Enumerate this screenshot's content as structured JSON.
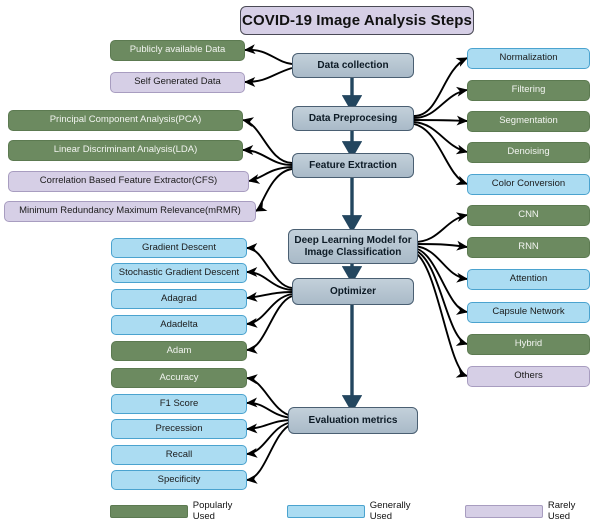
{
  "title": {
    "text": "COVID-19 Image Analysis Steps"
  },
  "spine": [
    {
      "id": "data-collection",
      "label": "Data collection"
    },
    {
      "id": "data-preprocessing",
      "label": "Data Preprocesing"
    },
    {
      "id": "feature-extraction",
      "label": "Feature Extraction"
    },
    {
      "id": "deep-learning-model",
      "label": "Deep Learning Model for Image Classification"
    },
    {
      "id": "optimizer",
      "label": "Optimizer"
    },
    {
      "id": "evaluation-metrics",
      "label": "Evaluation metrics"
    }
  ],
  "data_sources": [
    {
      "label": "Publicly available Data",
      "usage": "popularly"
    },
    {
      "label": "Self Generated Data",
      "usage": "rarely"
    }
  ],
  "preprocessing_steps": [
    {
      "label": "Normalization",
      "usage": "generally"
    },
    {
      "label": "Filtering",
      "usage": "popularly"
    },
    {
      "label": "Segmentation",
      "usage": "popularly"
    },
    {
      "label": "Denoising",
      "usage": "popularly"
    },
    {
      "label": "Color Conversion",
      "usage": "generally"
    }
  ],
  "feature_extractors": [
    {
      "label": "Principal Component Analysis(PCA)",
      "usage": "popularly"
    },
    {
      "label": "Linear Discriminant Analysis(LDA)",
      "usage": "popularly"
    },
    {
      "label": "Correlation Based Feature Extractor(CFS)",
      "usage": "rarely"
    },
    {
      "label": "Minimum Redundancy Maximum Relevance(mRMR)",
      "usage": "rarely"
    }
  ],
  "models": [
    {
      "label": "CNN",
      "usage": "popularly"
    },
    {
      "label": "RNN",
      "usage": "popularly"
    },
    {
      "label": "Attention",
      "usage": "generally"
    },
    {
      "label": "Capsule Network",
      "usage": "generally"
    },
    {
      "label": "Hybrid",
      "usage": "popularly"
    },
    {
      "label": "Others",
      "usage": "rarely"
    }
  ],
  "optimizers": [
    {
      "label": "Gradient Descent",
      "usage": "generally"
    },
    {
      "label": "Stochastic Gradient Descent",
      "usage": "generally"
    },
    {
      "label": "Adagrad",
      "usage": "generally"
    },
    {
      "label": "Adadelta",
      "usage": "generally"
    },
    {
      "label": "Adam",
      "usage": "popularly"
    }
  ],
  "metrics": [
    {
      "label": "Accuracy",
      "usage": "popularly"
    },
    {
      "label": "F1 Score",
      "usage": "generally"
    },
    {
      "label": "Precession",
      "usage": "generally"
    },
    {
      "label": "Recall",
      "usage": "generally"
    },
    {
      "label": "Specificity",
      "usage": "generally"
    }
  ],
  "legend": [
    {
      "label": "Popularly Used",
      "usage": "popularly",
      "color": "#6c8a60"
    },
    {
      "label": "Generally Used",
      "usage": "generally",
      "color": "#abdcf2"
    },
    {
      "label": "Rarely Used",
      "usage": "rarely",
      "color": "#d6cfe6"
    }
  ],
  "colors": {
    "popularly": "#6c8a60",
    "generally": "#abdcf2",
    "rarely": "#d6cfe6",
    "spine": "#b4c3cf",
    "arrow": "#1b3a52",
    "connector": "#000000"
  }
}
